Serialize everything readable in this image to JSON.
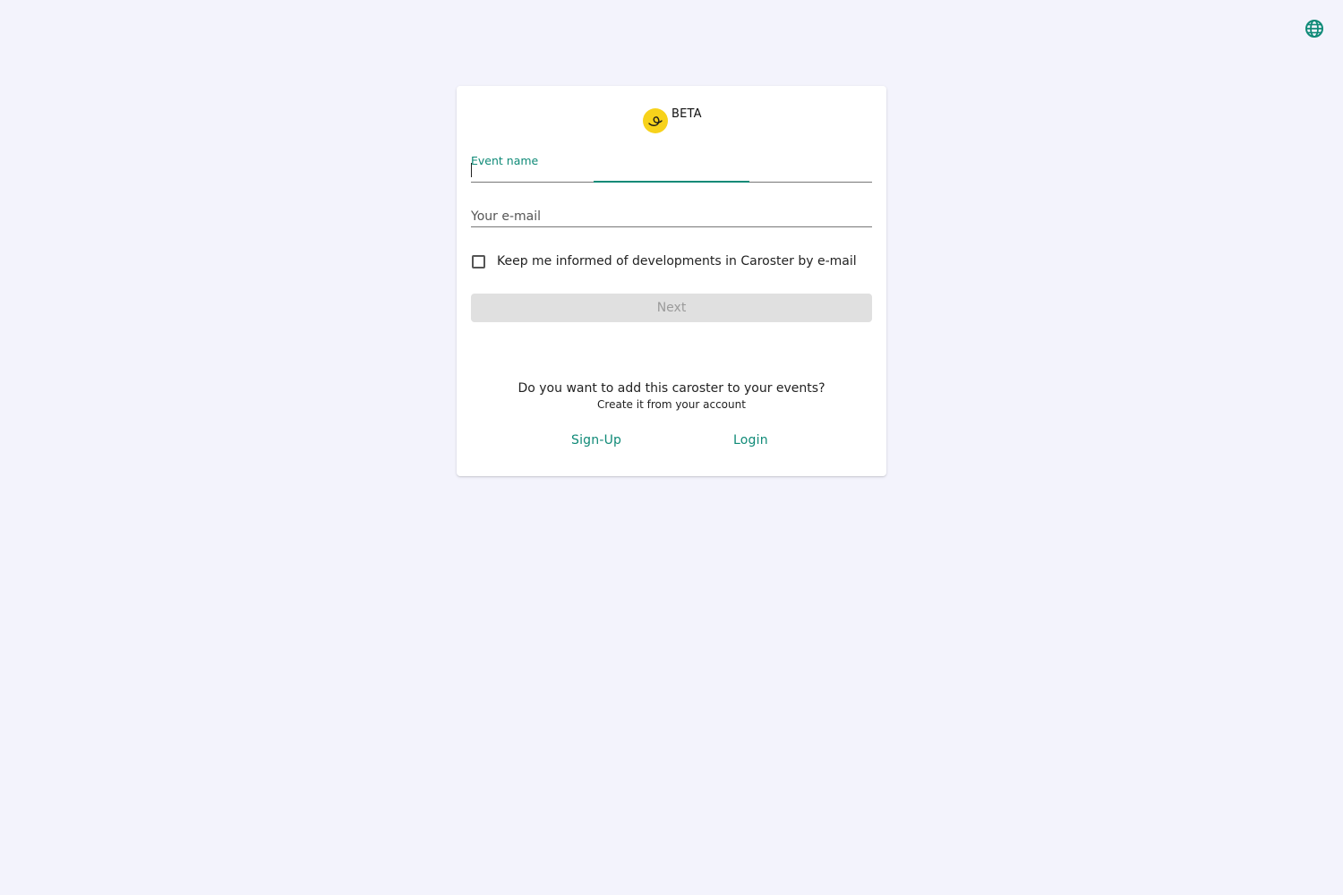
{
  "header": {
    "language_icon": "globe-icon",
    "accent_color": "#0f8a77"
  },
  "card": {
    "logo_icon": "caroster-logo",
    "badge": "BETA",
    "event_field": {
      "label": "Event name",
      "value": ""
    },
    "email_field": {
      "placeholder": "Your e-mail",
      "value": ""
    },
    "newsletter_checkbox": {
      "label": "Keep me informed of developments in Caroster by e-mail",
      "checked": false
    },
    "next_button": {
      "label": "Next",
      "disabled": true
    },
    "account_prompt": {
      "question": "Do you want to add this caroster to your events?",
      "subtext": "Create it from your account"
    },
    "signup_label": "Sign-Up",
    "login_label": "Login"
  },
  "colors": {
    "background": "#f3f3fc",
    "logo_yellow": "#f7d21b",
    "disabled_button": "#e0e0e0"
  }
}
